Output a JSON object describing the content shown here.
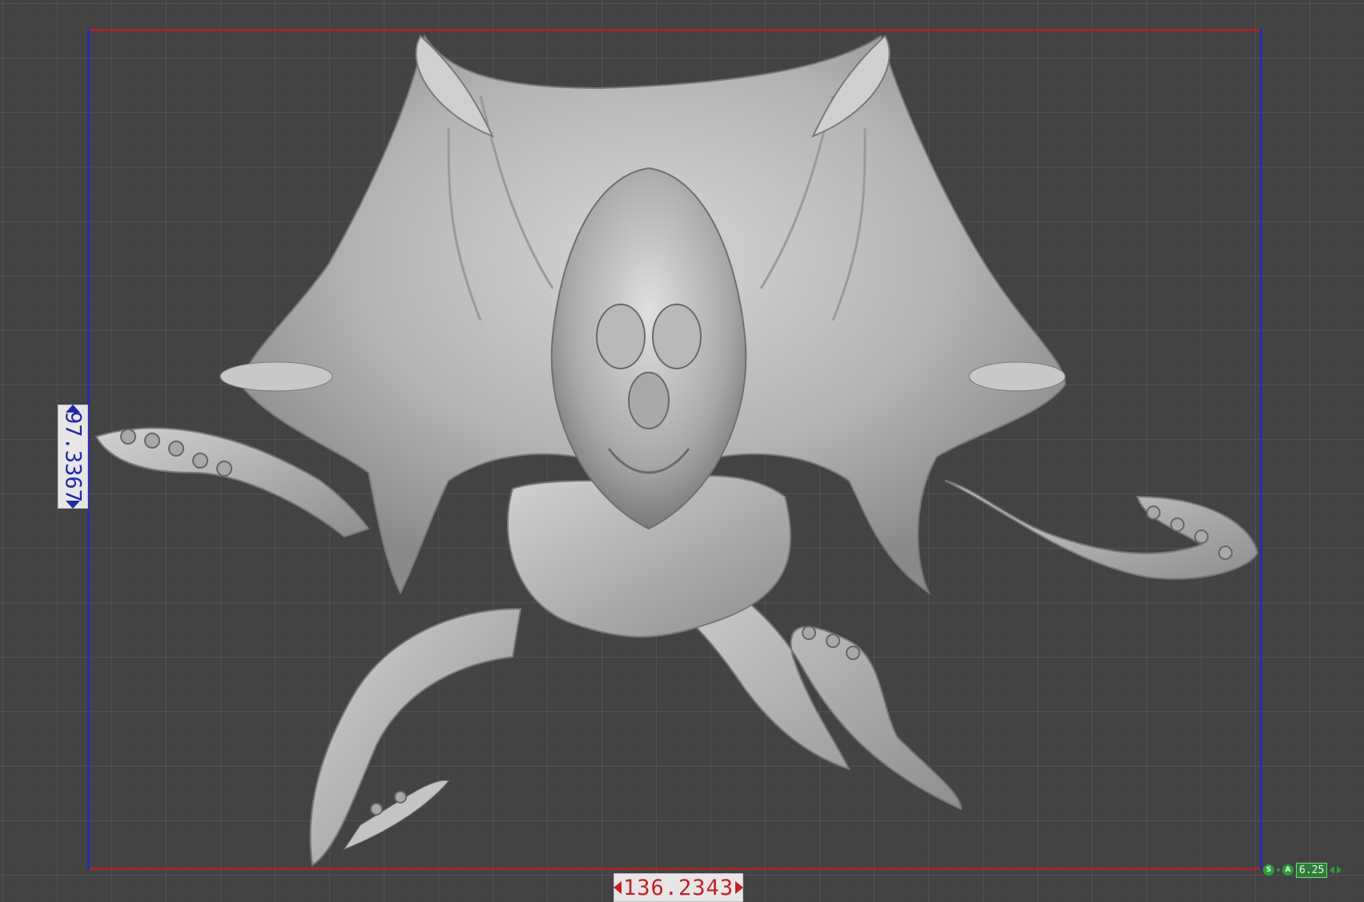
{
  "dimensions": {
    "width_label": "136.2343",
    "height_label": "97.3367"
  },
  "status_widget": {
    "s_label": "S",
    "a_label": "A",
    "zoom": "6.25"
  },
  "colors": {
    "width_axis": "#c21f27",
    "height_axis": "#1f2aa8",
    "status": "#2e9a3a",
    "background": "#434343",
    "model": "#bdbdbd"
  },
  "scene": {
    "model_icon": "creature-3d-model"
  }
}
